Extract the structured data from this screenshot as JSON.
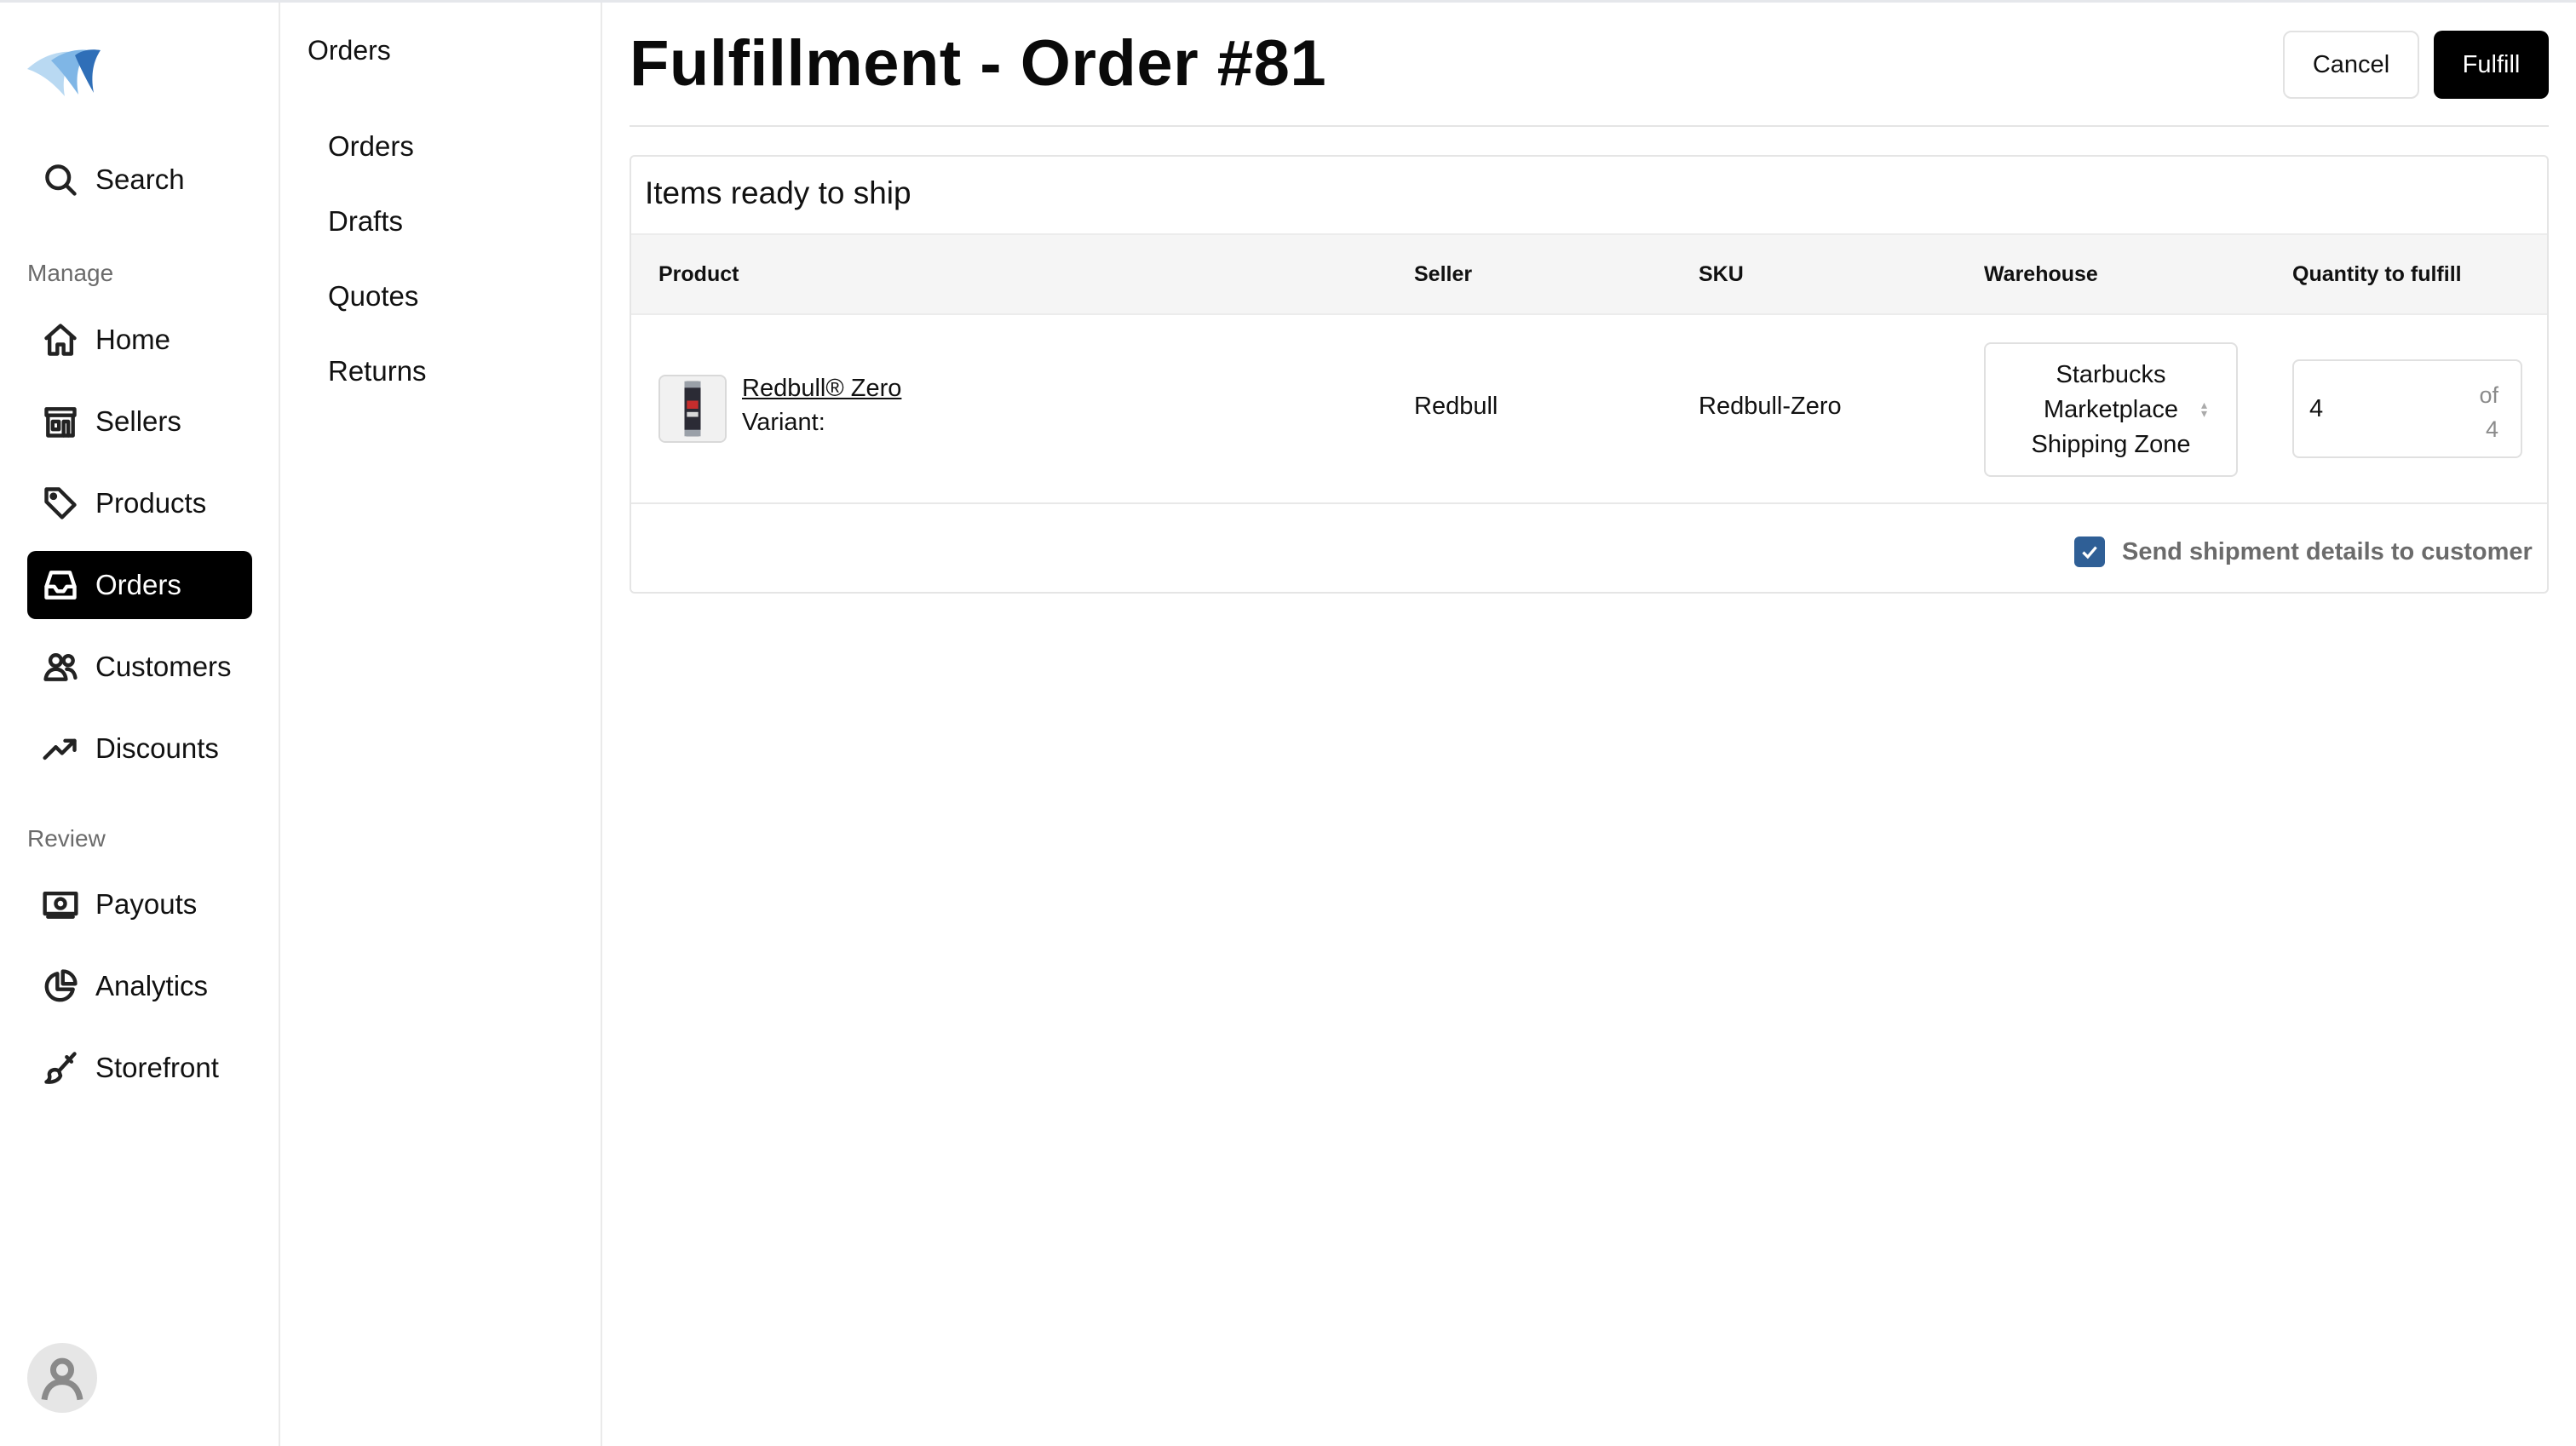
{
  "sidebar": {
    "search_label": "Search",
    "manage_label": "Manage",
    "review_label": "Review",
    "manage_items": [
      {
        "label": "Home",
        "icon": "home-icon"
      },
      {
        "label": "Sellers",
        "icon": "store-icon"
      },
      {
        "label": "Products",
        "icon": "tag-icon"
      },
      {
        "label": "Orders",
        "icon": "inbox-icon",
        "active": true
      },
      {
        "label": "Customers",
        "icon": "users-icon"
      },
      {
        "label": "Discounts",
        "icon": "trending-up-icon"
      }
    ],
    "review_items": [
      {
        "label": "Payouts",
        "icon": "banknote-icon"
      },
      {
        "label": "Analytics",
        "icon": "pie-chart-icon"
      },
      {
        "label": "Storefront",
        "icon": "brush-icon"
      }
    ],
    "active_color": "#000000"
  },
  "subnav": {
    "title": "Orders",
    "items": [
      {
        "label": "Orders"
      },
      {
        "label": "Drafts"
      },
      {
        "label": "Quotes"
      },
      {
        "label": "Returns"
      }
    ]
  },
  "header": {
    "title": "Fulfillment - Order #81",
    "cancel_label": "Cancel",
    "fulfill_label": "Fulfill"
  },
  "card": {
    "title": "Items ready to ship",
    "columns": [
      "Product",
      "Seller",
      "SKU",
      "Warehouse",
      "Quantity to fulfill"
    ],
    "rows": [
      {
        "product_name": "Redbull® Zero",
        "variant_label": "Variant:",
        "seller": "Redbull",
        "sku": "Redbull-Zero",
        "warehouse": "Starbucks Marketplace Shipping Zone",
        "quantity": "4",
        "quantity_of": "of",
        "quantity_total": "4"
      }
    ],
    "send_details_label": "Send shipment details to customer",
    "send_details_checked": true,
    "checkbox_color": "#2f5f96"
  }
}
